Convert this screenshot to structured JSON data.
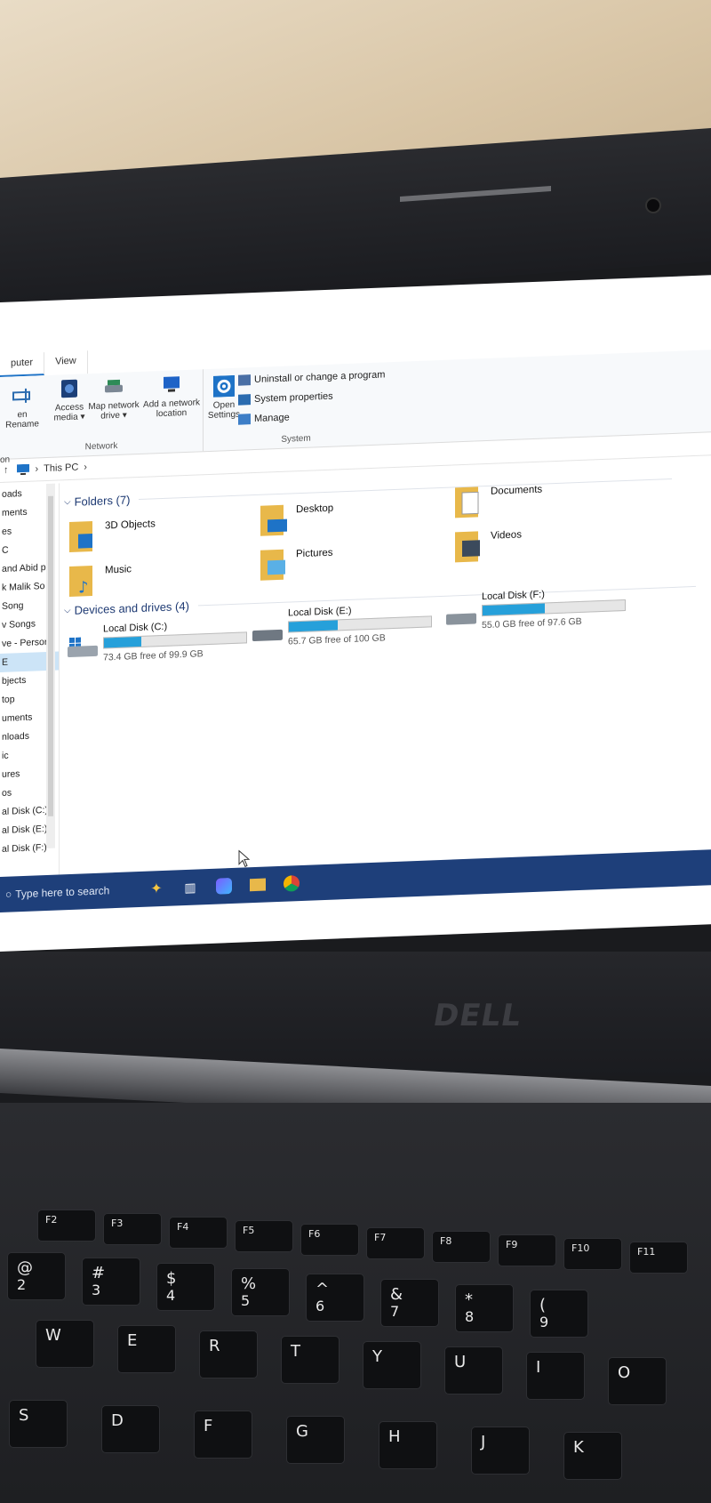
{
  "ribbon": {
    "tabs": [
      "puter",
      "View"
    ],
    "network_group": {
      "name": "Network",
      "buttons": [
        {
          "label": "en Rename"
        },
        {
          "label": "Access media ▾"
        },
        {
          "label": "Map network drive ▾"
        },
        {
          "label": "Add a network location"
        }
      ]
    },
    "open_settings": "Open Settings",
    "system_group": {
      "name": "System",
      "items": [
        "Uninstall or change a program",
        "System properties",
        "Manage"
      ]
    },
    "left_fragment": "on"
  },
  "address": {
    "path": "This PC",
    "sep": "›"
  },
  "nav": {
    "items": [
      "oads",
      "ments",
      "es",
      "C",
      "and Abid p",
      "k Malik So",
      "Song",
      "v Songs",
      "ve - Persor",
      "E",
      "bjects",
      "top",
      "uments",
      "nloads",
      "ic",
      "ures",
      "os",
      "al Disk (C:)",
      "al Disk (E:)",
      "al Disk (F:)"
    ]
  },
  "folders": {
    "heading": "Folders (7)",
    "items": [
      {
        "name": "3D Objects",
        "icon": "3d-objects-folder-icon"
      },
      {
        "name": "Desktop",
        "icon": "desktop-folder-icon"
      },
      {
        "name": "Documents",
        "icon": "documents-folder-icon"
      },
      {
        "name": "Music",
        "icon": "music-folder-icon"
      },
      {
        "name": "Pictures",
        "icon": "pictures-folder-icon"
      },
      {
        "name": "Videos",
        "icon": "videos-folder-icon"
      }
    ]
  },
  "drives": {
    "heading": "Devices and drives (4)",
    "items": [
      {
        "name": "Local Disk (C:)",
        "free": "73.4 GB free of 99.9 GB",
        "used_fraction": 0.265
      },
      {
        "name": "Local Disk (E:)",
        "free": "65.7 GB free of 100 GB",
        "used_fraction": 0.343
      },
      {
        "name": "Local Disk (F:)",
        "free": "55.0 GB free of 97.6 GB",
        "used_fraction": 0.436
      }
    ]
  },
  "taskbar": {
    "search_placeholder": "Type here to search",
    "icons": [
      "copilot-sparkle-icon",
      "task-view-icon",
      "copilot-icon",
      "file-explorer-icon",
      "chrome-icon"
    ]
  },
  "keyboard": {
    "fn_row": [
      "F2",
      "F3",
      "F4",
      "F5",
      "F6",
      "F7",
      "F8",
      "F9",
      "F10",
      "F11"
    ],
    "num_row": [
      [
        "@",
        "2"
      ],
      [
        "#",
        "3"
      ],
      [
        "$",
        "4"
      ],
      [
        "%",
        "5"
      ],
      [
        "^",
        "6"
      ],
      [
        "&",
        "7"
      ],
      [
        "*",
        "8"
      ],
      [
        "(",
        "9"
      ]
    ],
    "row_qwe": [
      "W",
      "E",
      "R",
      "T",
      "Y",
      "U",
      "I",
      "O"
    ],
    "row_asd": [
      "S",
      "D",
      "F",
      "G",
      "H",
      "J",
      "K"
    ]
  },
  "brand": "DELL",
  "colors": {
    "accent": "#26a0da",
    "taskbar": "#1e3f7a",
    "section_title": "#1e3a73"
  }
}
